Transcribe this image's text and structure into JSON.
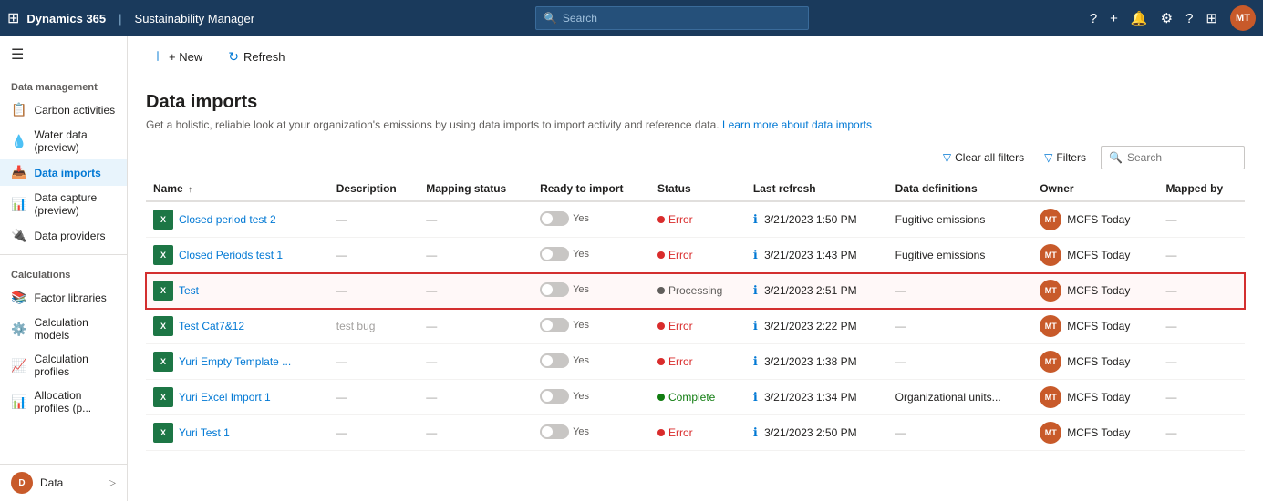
{
  "topnav": {
    "logo": "Dynamics 365",
    "sep": "|",
    "app": "Sustainability Manager",
    "search_placeholder": "Search"
  },
  "sidebar": {
    "hamburger": "☰",
    "sections": [
      {
        "label": "Data management",
        "items": [
          {
            "id": "carbon-activities",
            "label": "Carbon activities",
            "icon": "📋"
          },
          {
            "id": "water-data",
            "label": "Water data (preview)",
            "icon": "💧"
          },
          {
            "id": "data-imports",
            "label": "Data imports",
            "icon": "📥",
            "active": true
          },
          {
            "id": "data-capture",
            "label": "Data capture (preview)",
            "icon": "📊"
          },
          {
            "id": "data-providers",
            "label": "Data providers",
            "icon": "🔌"
          }
        ]
      },
      {
        "label": "Calculations",
        "items": [
          {
            "id": "factor-libraries",
            "label": "Factor libraries",
            "icon": "📚"
          },
          {
            "id": "calculation-models",
            "label": "Calculation models",
            "icon": "⚙️"
          },
          {
            "id": "calculation-profiles",
            "label": "Calculation profiles",
            "icon": "📈"
          },
          {
            "id": "allocation-profiles",
            "label": "Allocation profiles (p...",
            "icon": "📊"
          }
        ]
      }
    ],
    "bottom": {
      "label": "Data",
      "chevron": "▷"
    }
  },
  "toolbar": {
    "new_label": "+ New",
    "refresh_label": "↻ Refresh"
  },
  "main": {
    "title": "Data imports",
    "description": "Get a holistic, reliable look at your organization's emissions by using data imports to import activity and reference data.",
    "learn_more": "Learn more about data imports",
    "clear_filters_label": "Clear all filters",
    "filters_label": "Filters",
    "search_placeholder": "Search"
  },
  "table": {
    "columns": [
      {
        "id": "name",
        "label": "Name",
        "sort": "↑"
      },
      {
        "id": "description",
        "label": "Description"
      },
      {
        "id": "mapping_status",
        "label": "Mapping status"
      },
      {
        "id": "ready_to_import",
        "label": "Ready to import"
      },
      {
        "id": "status",
        "label": "Status"
      },
      {
        "id": "last_refresh",
        "label": "Last refresh"
      },
      {
        "id": "data_definitions",
        "label": "Data definitions"
      },
      {
        "id": "owner",
        "label": "Owner"
      },
      {
        "id": "mapped_by",
        "label": "Mapped by"
      }
    ],
    "rows": [
      {
        "id": "row-1",
        "name": "Closed period test 2",
        "description": "—",
        "mapping_status": "—",
        "ready_to_import": "Yes",
        "status": "Error",
        "status_type": "error",
        "last_refresh": "3/21/2023 1:50 PM",
        "data_definitions": "Fugitive emissions",
        "owner": "MT",
        "owner_label": "MCFS Today",
        "mapped_by": "—",
        "highlighted": false
      },
      {
        "id": "row-2",
        "name": "Closed Periods test 1",
        "description": "—",
        "mapping_status": "—",
        "ready_to_import": "Yes",
        "status": "Error",
        "status_type": "error",
        "last_refresh": "3/21/2023 1:43 PM",
        "data_definitions": "Fugitive emissions",
        "owner": "MT",
        "owner_label": "MCFS Today",
        "mapped_by": "—",
        "highlighted": false
      },
      {
        "id": "row-3",
        "name": "Test",
        "description": "—",
        "mapping_status": "—",
        "ready_to_import": "Yes",
        "status": "Processing",
        "status_type": "processing",
        "last_refresh": "3/21/2023 2:51 PM",
        "data_definitions": "—",
        "owner": "MT",
        "owner_label": "MCFS Today",
        "mapped_by": "—",
        "highlighted": true
      },
      {
        "id": "row-4",
        "name": "Test Cat7&12",
        "description": "test bug",
        "mapping_status": "—",
        "ready_to_import": "Yes",
        "status": "Error",
        "status_type": "error",
        "last_refresh": "3/21/2023 2:22 PM",
        "data_definitions": "—",
        "owner": "MT",
        "owner_label": "MCFS Today",
        "mapped_by": "—",
        "highlighted": false
      },
      {
        "id": "row-5",
        "name": "Yuri Empty Template ...",
        "description": "—",
        "mapping_status": "—",
        "ready_to_import": "Yes",
        "status": "Error",
        "status_type": "error",
        "last_refresh": "3/21/2023 1:38 PM",
        "data_definitions": "—",
        "owner": "MT",
        "owner_label": "MCFS Today",
        "mapped_by": "—",
        "highlighted": false
      },
      {
        "id": "row-6",
        "name": "Yuri Excel Import 1",
        "description": "—",
        "mapping_status": "—",
        "ready_to_import": "Yes",
        "status": "Complete",
        "status_type": "complete",
        "last_refresh": "3/21/2023 1:34 PM",
        "data_definitions": "Organizational units...",
        "owner": "MT",
        "owner_label": "MCFS Today",
        "mapped_by": "—",
        "highlighted": false
      },
      {
        "id": "row-7",
        "name": "Yuri Test 1",
        "description": "—",
        "mapping_status": "—",
        "ready_to_import": "Yes",
        "status": "Error",
        "status_type": "error",
        "last_refresh": "3/21/2023 2:50 PM",
        "data_definitions": "—",
        "owner": "MT",
        "owner_label": "MCFS Today",
        "mapped_by": "—",
        "highlighted": false
      }
    ]
  }
}
